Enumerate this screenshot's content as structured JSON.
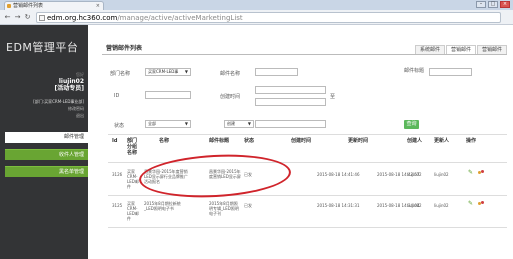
{
  "browser": {
    "tab_title": "营销邮件列表",
    "url_host": "edm.org.hc360.com",
    "url_path": "/manage/active/activeMarketingList",
    "window_controls": [
      "–",
      "□",
      "×"
    ]
  },
  "sidebar": {
    "brand": "EDM管理平台",
    "greeting_label": "您好",
    "username": "liujin02",
    "role": "[活动专员]",
    "department": "[部门:买家CRM-LED事业部]",
    "links": [
      "修改密码",
      "退出"
    ],
    "menu": [
      {
        "label": "邮件管理"
      },
      {
        "label": "收件人管理"
      },
      {
        "label": "黑名单管理"
      }
    ]
  },
  "main": {
    "title": "营销邮件列表",
    "tabs": [
      "系统邮件",
      "营销邮件",
      "营销邮件"
    ],
    "filters": {
      "dept_label": "部门名称",
      "dept_value": "买家CRM-LED事",
      "subject_label": "邮件名称",
      "sender_label": "邮件标题",
      "id_label": "ID",
      "created_label": "创建时间",
      "range_sep": "至",
      "status_label": "状态",
      "status_value": "全部",
      "creator_label": "创建",
      "search_label": "查询"
    },
    "table": {
      "headers": [
        "Id",
        "部门分组名称",
        "名称",
        "邮件标题",
        "状态",
        "创建时间",
        "更新时间",
        "创建人",
        "更新人",
        "操作"
      ],
      "rows": [
        {
          "id": "3126",
          "dept": "买家CRM-LED邮件",
          "name": "昌景华园-2015年度营销LED显示屏行业品牌推广活动报名",
          "subject": "昌景华园-2015年度营销LED显示屏",
          "status": "已发",
          "created": "2015-08-18 14:41:46",
          "updated": "2015-08-18 14:42:57",
          "creator": "liujin02",
          "updater": "liujin02"
        },
        {
          "id": "3125",
          "dept": "买家CRM-LED邮件",
          "name": "2015年8月期拉新统_LED照明电子书",
          "subject": "2015年8月期照明专辑_LED照明电子刊",
          "status": "已发",
          "created": "2015-08-18 14:31:31",
          "updated": "2015-08-18 14:34:04",
          "creator": "liujin02",
          "updater": "liujin02"
        }
      ]
    }
  },
  "colors": {
    "sidebar_bg": "#333436",
    "menu_green": "#69a533",
    "search_green": "#5cb85c",
    "annotation_red": "#d0242b"
  }
}
